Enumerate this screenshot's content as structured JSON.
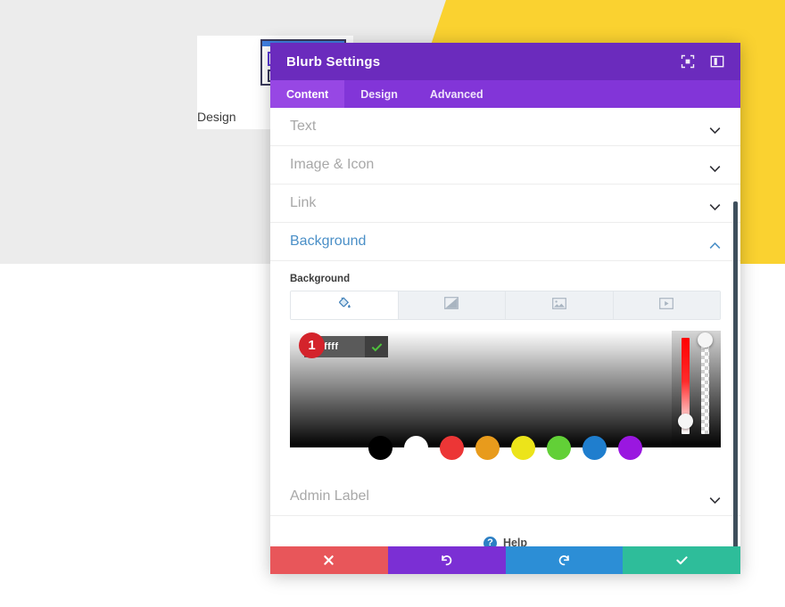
{
  "backdrop": {
    "card_label": "Design",
    "gray_color": "#ececec",
    "yellow_color": "#fad230"
  },
  "modal": {
    "title": "Blurb Settings",
    "header_color": "#6b2bbd",
    "tabbar_color": "#8235d8",
    "header_icons": [
      {
        "name": "fullscreen-icon"
      },
      {
        "name": "panel-layout-icon"
      }
    ],
    "tabs": [
      {
        "label": "Content",
        "active": true
      },
      {
        "label": "Design",
        "active": false
      },
      {
        "label": "Advanced",
        "active": false
      }
    ],
    "sections": [
      {
        "label": "Text",
        "open": false
      },
      {
        "label": "Image & Icon",
        "open": false
      },
      {
        "label": "Link",
        "open": false
      },
      {
        "label": "Background",
        "open": true
      },
      {
        "label": "Admin Label",
        "open": false
      }
    ],
    "background_panel": {
      "field_label": "Background",
      "type_tabs": [
        {
          "name": "background-color-tab",
          "icon": "paint-bucket-icon",
          "active": true
        },
        {
          "name": "background-gradient-tab",
          "icon": "gradient-icon",
          "active": false
        },
        {
          "name": "background-image-tab",
          "icon": "image-icon",
          "active": false
        },
        {
          "name": "background-video-tab",
          "icon": "video-icon",
          "active": false
        }
      ],
      "color_picker": {
        "hex_value": "#ffffff",
        "hex_placeholder": "#ffffff",
        "confirm_icon": "checkmark-icon",
        "badge_number": "1",
        "hue_slider_label": "hue",
        "alpha_slider_label": "alpha",
        "swatches": [
          {
            "name": "swatch-black",
            "color": "#000000"
          },
          {
            "name": "swatch-white",
            "color": "#ffffff"
          },
          {
            "name": "swatch-red",
            "color": "#ec3636"
          },
          {
            "name": "swatch-orange",
            "color": "#e89b1c"
          },
          {
            "name": "swatch-yellow",
            "color": "#ece41a"
          },
          {
            "name": "swatch-green",
            "color": "#62d037"
          },
          {
            "name": "swatch-blue",
            "color": "#1f7ece"
          },
          {
            "name": "swatch-purple",
            "color": "#9a17e0"
          }
        ]
      }
    },
    "help": {
      "label": "Help",
      "icon_char": "?"
    },
    "footer_buttons": [
      {
        "name": "cancel-button",
        "icon": "close-icon",
        "color": "#e8565a"
      },
      {
        "name": "undo-button",
        "icon": "undo-icon",
        "color": "#7b2fd4"
      },
      {
        "name": "redo-button",
        "icon": "redo-icon",
        "color": "#2c8ed6"
      },
      {
        "name": "save-button",
        "icon": "check-icon",
        "color": "#2ebd9a"
      }
    ]
  }
}
